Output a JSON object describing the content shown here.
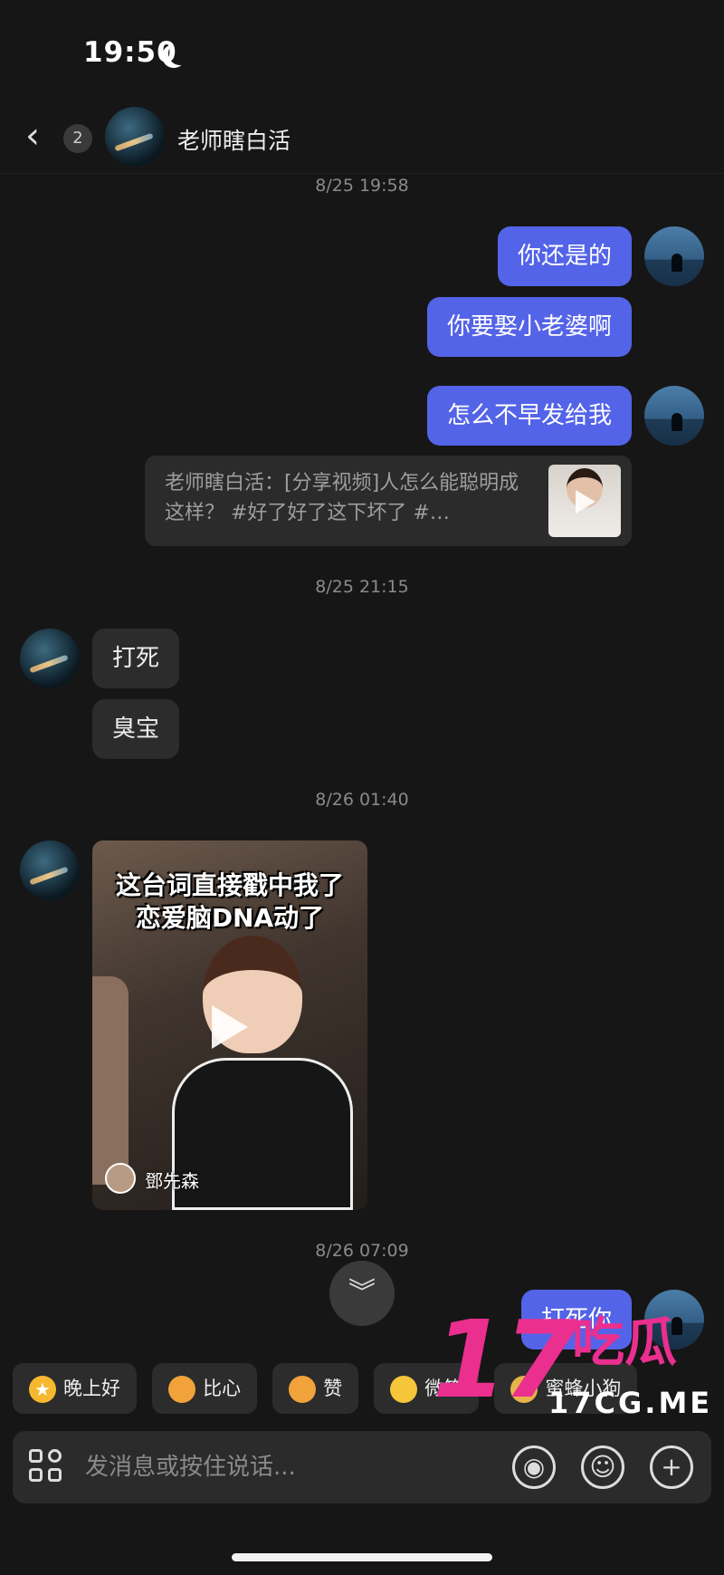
{
  "status_bar": {
    "time": "19:50"
  },
  "header": {
    "back_badge": "2",
    "contact_name": "老师瞎白活"
  },
  "messages": {
    "ts1": "8/25 19:58",
    "out1": "你还是的",
    "out2": "你要娶小老婆啊",
    "out3": "怎么不早发给我",
    "share_card_text": "老师瞎白活：[分享视频]人怎么能聪明成这样？ #好了好了这下坏了 #…",
    "ts2": "8/25 21:15",
    "in1": "打死",
    "in2": "臭宝",
    "ts3": "8/26 01:40",
    "video_title_line1": "这台词直接戳中我了",
    "video_title_line2": "恋爱脑DNA动了",
    "video_author": "鄧先森",
    "ts4": "8/26 07:09",
    "out4": "打死你"
  },
  "quick_replies": [
    {
      "label": "晚上好",
      "icon": "star-emoji-icon",
      "color": "#f5b82e"
    },
    {
      "label": "比心",
      "icon": "heart-hands-emoji-icon",
      "color": "#f2a23a"
    },
    {
      "label": "赞",
      "icon": "thumbs-up-emoji-icon",
      "color": "#f2a23a"
    },
    {
      "label": "微笑",
      "icon": "smile-emoji-icon",
      "color": "#f5c63a"
    },
    {
      "label": "蜜蜂小狗",
      "icon": "bee-dog-emoji-icon",
      "color": "#e6b34a"
    }
  ],
  "composer": {
    "placeholder": "发消息或按住说话..."
  },
  "watermark": {
    "number": "17",
    "cn": "吃瓜",
    "url": "17CG.ME"
  },
  "colors": {
    "bubble_out": "#5464e8",
    "bubble_in": "#2c2c2c",
    "background": "#161616",
    "watermark": "#ea2f8f"
  }
}
